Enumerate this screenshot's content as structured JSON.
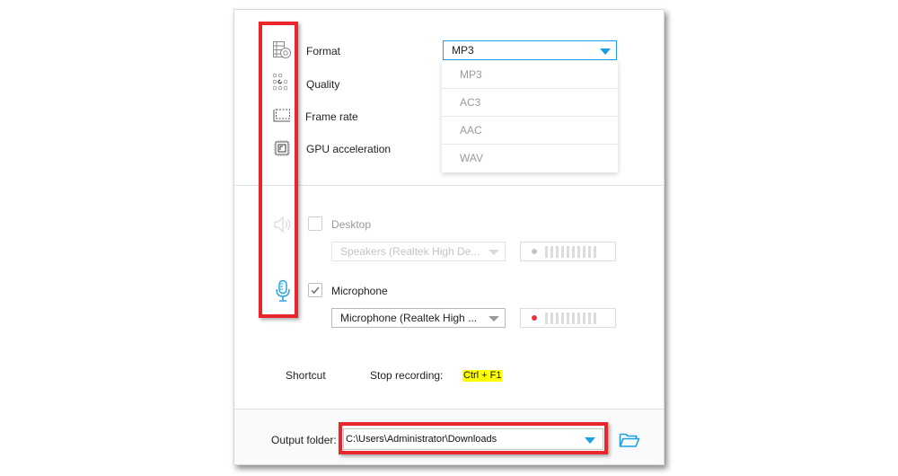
{
  "settings": {
    "rows": [
      {
        "label": "Format",
        "icon": "format-settings-icon"
      },
      {
        "label": "Quality",
        "icon": "quality-dots-icon"
      },
      {
        "label": "Frame rate",
        "icon": "frame-rate-icon"
      },
      {
        "label": "GPU acceleration",
        "icon": "gpu-chip-icon"
      }
    ],
    "format": {
      "selected": "MP3",
      "options": [
        "MP3",
        "AC3",
        "AAC",
        "WAV"
      ]
    }
  },
  "audio": {
    "desktop": {
      "label": "Desktop",
      "checked": false,
      "device": "Speakers (Realtek High De...",
      "icon": "speaker-icon",
      "indicator_color": "#c4c4c4"
    },
    "microphone": {
      "label": "Microphone",
      "checked": true,
      "device": "Microphone (Realtek High ...",
      "icon": "microphone-icon",
      "indicator_color": "#e8333a"
    }
  },
  "shortcut": {
    "label": "Shortcut",
    "action": "Stop recording:",
    "key": "Ctrl + F1"
  },
  "output": {
    "label": "Output folder:",
    "path": "C:\\Users\\Administrator\\Downloads",
    "icon": "folder-open-icon"
  },
  "colors": {
    "accent": "#1a9ee5",
    "highlight": "#e8262b",
    "shortcut_highlight": "#ffff00",
    "record_dot": "#e8333a"
  }
}
